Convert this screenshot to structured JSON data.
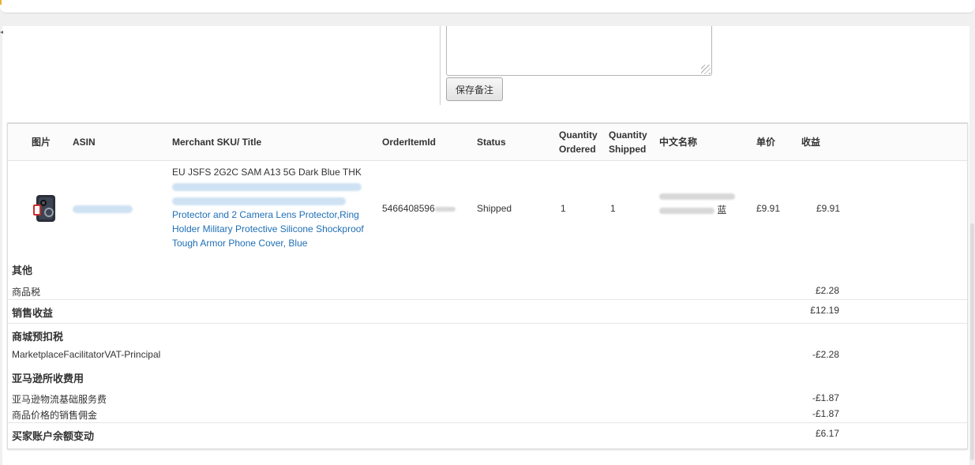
{
  "note": {
    "save_label": "保存备注"
  },
  "table": {
    "headers": {
      "image": "图片",
      "asin": "ASIN",
      "sku_title": "Merchant SKU/ Title",
      "order_item_id": "OrderItemId",
      "status": "Status",
      "qty_ordered_1": "Quantity",
      "qty_ordered_2": "Ordered",
      "qty_shipped_1": "Quantity",
      "qty_shipped_2": "Shipped",
      "cn_name": "中文名称",
      "unit_price": "单价",
      "revenue": "收益"
    },
    "row": {
      "sku": "EU JSFS 2G2C SAM A13 5G Dark Blue THK",
      "title_visible_1": "Protector and 2 Camera Lens Protector,Ring",
      "title_visible_2": "Holder Military Protective Silicone Shockproof",
      "title_visible_3": "Tough Armor Phone Cover, Blue",
      "order_item_id": "5466408596",
      "status": "Shipped",
      "qty_ordered": "1",
      "qty_shipped": "1",
      "cn_name_visible": "蓝",
      "unit_price": "£9.91",
      "revenue": "£9.91"
    }
  },
  "summary": {
    "other_title": "其他",
    "product_tax_label": "商品税",
    "product_tax_value": "£2.28",
    "sales_revenue_label": "销售收益",
    "sales_revenue_value": "£12.19",
    "marketplace_withheld_title": "商城预扣税",
    "marketplace_vat_label": "MarketplaceFacilitatorVAT-Principal",
    "marketplace_vat_value": "-£2.28",
    "amazon_fees_title": "亚马逊所收费用",
    "fba_fee_label": "亚马逊物流基础服务费",
    "fba_fee_value": "-£1.87",
    "commission_label": "商品价格的销售佣金",
    "commission_value": "-£1.87",
    "buyer_balance_label": "买家账户余额变动",
    "buyer_balance_value": "£6.17"
  },
  "colors": {
    "link": "#1f6fb5",
    "accent_mark": "#e8b13a"
  },
  "icons": {
    "resize_grip": "resize-grip-icon",
    "scroll_arrow": "chevron-left-icon"
  }
}
